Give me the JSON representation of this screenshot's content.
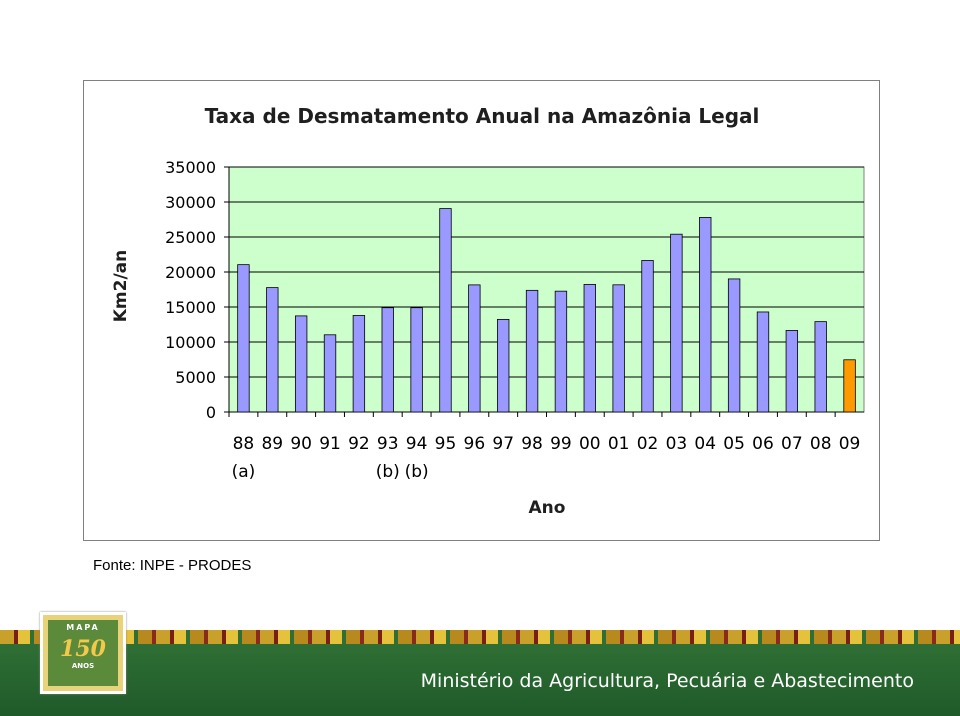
{
  "chart_data": {
    "type": "bar",
    "title": "Taxa de Desmatamento Anual na Amazônia Legal",
    "xlabel": "Ano",
    "ylabel": "Km2/an",
    "ylim": [
      0,
      35000
    ],
    "yticks": [
      0,
      5000,
      10000,
      15000,
      20000,
      25000,
      30000,
      35000
    ],
    "grid": true,
    "categories": [
      "88",
      "89",
      "90",
      "91",
      "92",
      "93",
      "94",
      "95",
      "96",
      "97",
      "98",
      "99",
      "00",
      "01",
      "02",
      "03",
      "04",
      "05",
      "06",
      "07",
      "08",
      "09"
    ],
    "sublabels": [
      "(a)",
      "",
      "",
      "",
      "",
      "(b)",
      "(b)",
      "",
      "",
      "",
      "",
      "",
      "",
      "",
      "",
      "",
      "",
      "",
      "",
      "",
      "",
      ""
    ],
    "values": [
      21050,
      17770,
      13730,
      11030,
      13790,
      14900,
      14900,
      29060,
      18160,
      13230,
      17380,
      17260,
      18230,
      18170,
      21650,
      25400,
      27800,
      19010,
      14290,
      11650,
      12910,
      7460
    ],
    "colors": {
      "bar": "#9999ff",
      "highlight_bar": "#ff9900",
      "plot_background": "#ccffcc",
      "title_color": "#1f1f1f"
    },
    "highlight_index": 21
  },
  "source": "Fonte: INPE - PRODES",
  "footer": {
    "ministry": "Ministério da Agricultura, Pecuária e Abastecimento",
    "logo_top": "MAPA",
    "logo_number": "150",
    "logo_sub": "ANOS"
  }
}
